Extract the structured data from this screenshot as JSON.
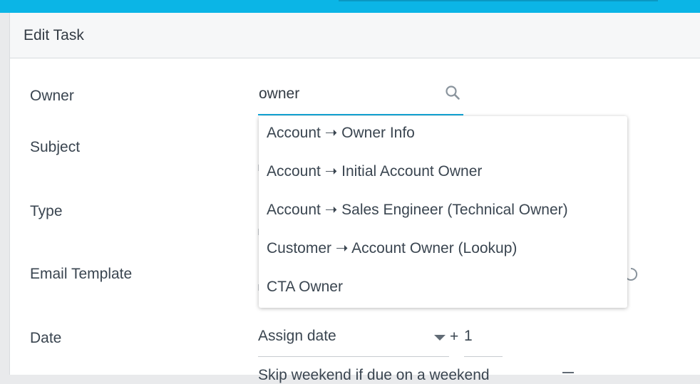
{
  "panel": {
    "title": "Edit Task"
  },
  "fields": {
    "owner_label": "Owner",
    "subject_label": "Subject",
    "type_label": "Type",
    "email_template_label": "Email Template",
    "date_label": "Date"
  },
  "owner_search": {
    "value": "owner",
    "icon": "search-icon"
  },
  "owner_dropdown": {
    "items": [
      {
        "label": "Account ➝ Owner Info"
      },
      {
        "label": "Account ➝ Initial Account Owner"
      },
      {
        "label": "Account ➝ Sales Engineer (Technical Owner)"
      },
      {
        "label": "Customer ➝ Account Owner (Lookup)"
      },
      {
        "label": "CTA Owner"
      }
    ]
  },
  "date": {
    "select_value": "Assign date",
    "plus": "+",
    "offset_value": "1"
  },
  "skip_weekend": {
    "text": "Skip weekend if due on a weekend"
  },
  "colors": {
    "accent": "#12a6d8",
    "topbar": "#0bb5e6",
    "text": "#3a4550"
  }
}
